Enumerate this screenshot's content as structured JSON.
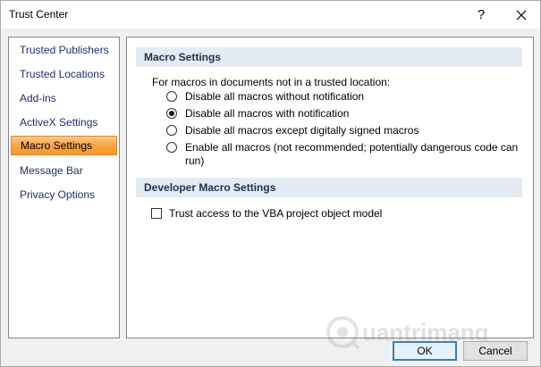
{
  "window": {
    "title": "Trust Center",
    "help_label": "?",
    "close_icon": "close-icon"
  },
  "sidebar": {
    "items": [
      {
        "label": "Trusted Publishers"
      },
      {
        "label": "Trusted Locations"
      },
      {
        "label": "Add-ins"
      },
      {
        "label": "ActiveX Settings"
      },
      {
        "label": "Macro Settings",
        "selected": true
      },
      {
        "label": "Message Bar"
      },
      {
        "label": "Privacy Options"
      }
    ]
  },
  "macro_settings": {
    "header": "Macro Settings",
    "intro": "For macros in documents not in a trusted location:",
    "options": [
      {
        "label": "Disable all macros without notification",
        "checked": false
      },
      {
        "label": "Disable all macros with notification",
        "checked": true
      },
      {
        "label": "Disable all macros except digitally signed macros",
        "checked": false
      },
      {
        "label_line1": "Enable all macros (not recommended; potentially dangerous code can",
        "label_line2": "run)",
        "checked": false
      }
    ]
  },
  "developer_settings": {
    "header": "Developer Macro Settings",
    "trust_vba_label": "Trust access to the VBA project object model",
    "trust_vba_checked": false
  },
  "watermark": {
    "text": "uantrimang"
  },
  "buttons": {
    "ok": "OK",
    "cancel": "Cancel"
  },
  "colors": {
    "selected_nav": "#f8a040",
    "section_header_bg": "#e4ebf2",
    "default_button_border": "#3c7fb1"
  }
}
